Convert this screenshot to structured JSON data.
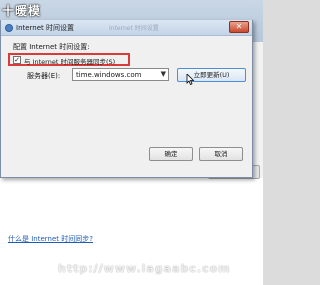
{
  "watermark_top": "十暖模",
  "watermark_bottom": "http://www.lagaabc.com",
  "dialog": {
    "title": "Internet 时间设置",
    "title_ghost": "Internet 时间设置",
    "close_glyph": "✕",
    "section_label": "配置 Internet 时间设置:",
    "sync_checkbox": {
      "checked": true,
      "mark": "✓",
      "label": "与 Internet 时间服务器同步(S)"
    },
    "server_label": "服务器(E):",
    "server_value": "time.windows.com",
    "select_arrow": "▼",
    "update_button": "立即更新(U)",
    "ok_button": "确定",
    "cancel_button": "取消"
  },
  "background": {
    "link_text": "什么是 Internet 时间同步?"
  },
  "colors": {
    "highlight_border": "#d93a3a",
    "link": "#1e5bb8",
    "focus_border": "#4a90d9"
  },
  "icons": {
    "title": "clock-icon",
    "cursor": "mouse-pointer-icon"
  }
}
